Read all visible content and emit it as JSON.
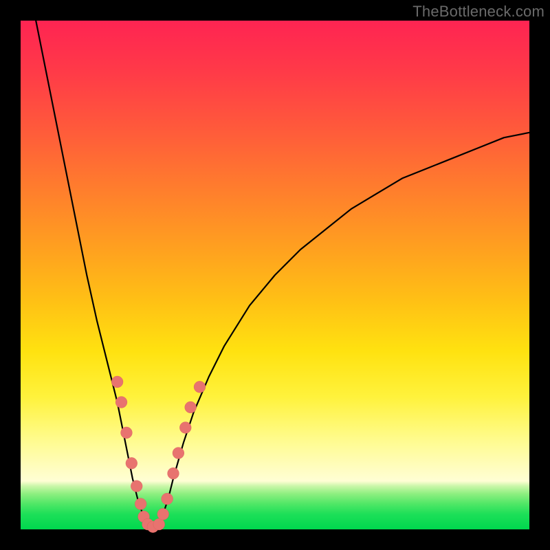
{
  "watermark": "TheBottleneck.com",
  "chart_data": {
    "type": "line",
    "title": "",
    "xlabel": "",
    "ylabel": "",
    "xlim": [
      0,
      100
    ],
    "ylim": [
      0,
      100
    ],
    "grid": false,
    "legend": false,
    "background_gradient": {
      "direction": "vertical",
      "stops": [
        {
          "pos": 0,
          "color": "#ff2452"
        },
        {
          "pos": 0.33,
          "color": "#ff7d2d"
        },
        {
          "pos": 0.65,
          "color": "#ffe210"
        },
        {
          "pos": 0.9,
          "color": "#fffed4"
        },
        {
          "pos": 1.0,
          "color": "#00d84e"
        }
      ]
    },
    "series": [
      {
        "name": "left-branch",
        "color": "#000000",
        "x": [
          3,
          5,
          7,
          9,
          11,
          13,
          15,
          17,
          19,
          20,
          21,
          22,
          23,
          24,
          25
        ],
        "y": [
          100,
          90,
          80,
          70,
          60,
          50,
          41,
          33,
          25,
          20,
          15,
          10,
          6,
          3,
          0
        ]
      },
      {
        "name": "right-branch",
        "color": "#000000",
        "x": [
          27,
          28,
          29,
          30,
          32,
          34,
          37,
          40,
          45,
          50,
          55,
          60,
          65,
          70,
          75,
          80,
          85,
          90,
          95,
          100
        ],
        "y": [
          0,
          3,
          6,
          10,
          17,
          23,
          30,
          36,
          44,
          50,
          55,
          59,
          63,
          66,
          69,
          71,
          73,
          75,
          77,
          78
        ]
      }
    ],
    "scatter": {
      "name": "highlight-dots",
      "color": "#e8736f",
      "points": [
        {
          "x": 19.0,
          "y": 29
        },
        {
          "x": 19.8,
          "y": 25
        },
        {
          "x": 20.8,
          "y": 19
        },
        {
          "x": 21.8,
          "y": 13
        },
        {
          "x": 22.8,
          "y": 8.5
        },
        {
          "x": 23.6,
          "y": 5
        },
        {
          "x": 24.2,
          "y": 2.5
        },
        {
          "x": 25.0,
          "y": 1
        },
        {
          "x": 26.0,
          "y": 0.5
        },
        {
          "x": 27.2,
          "y": 1
        },
        {
          "x": 28.0,
          "y": 3
        },
        {
          "x": 28.8,
          "y": 6
        },
        {
          "x": 30.0,
          "y": 11
        },
        {
          "x": 31.0,
          "y": 15
        },
        {
          "x": 32.4,
          "y": 20
        },
        {
          "x": 33.4,
          "y": 24
        },
        {
          "x": 35.2,
          "y": 28
        }
      ]
    }
  }
}
